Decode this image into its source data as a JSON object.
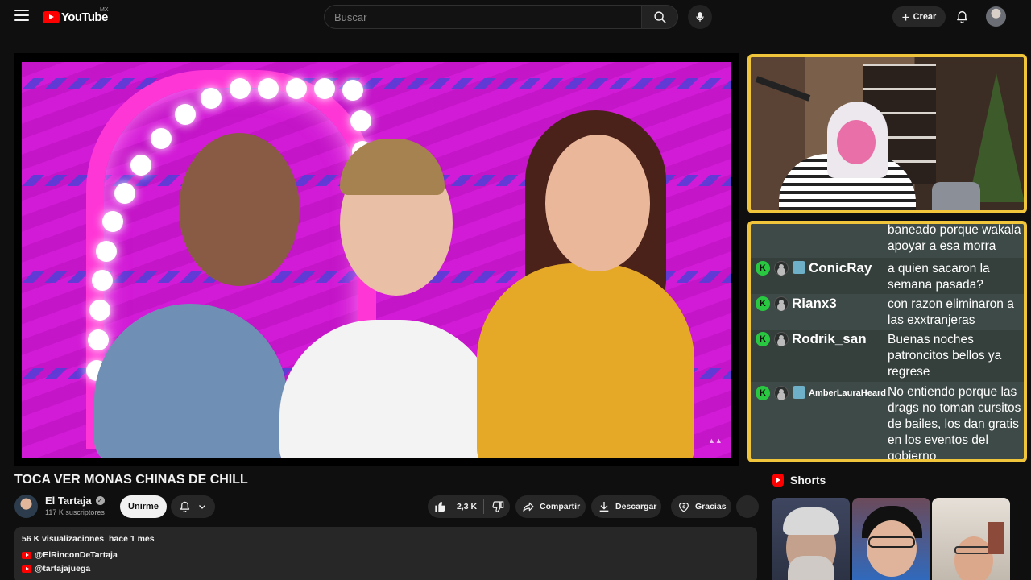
{
  "header": {
    "logo_text": "YouTube",
    "country_code": "MX",
    "search_placeholder": "Buscar",
    "create_label": "Crear"
  },
  "video": {
    "title": "TOCA VER MONAS CHINAS DE CHILL",
    "channel_name": "El Tartaja",
    "subscribers": "117 K suscriptores",
    "join_label": "Unirme",
    "likes": "2,3 K",
    "share_label": "Compartir",
    "download_label": "Descargar",
    "thanks_label": "Gracias"
  },
  "description": {
    "views": "56 K visualizaciones",
    "date": "hace 1 mes",
    "links": [
      "@ElRinconDeTartaja",
      "@tartajajuega"
    ]
  },
  "chat": {
    "messages": [
      {
        "user": "",
        "text": "baneado porque wakala apoyar a esa morra"
      },
      {
        "user": "ConicRay",
        "text": "a quien sacaron la semana pasada?"
      },
      {
        "user": "Rianx3",
        "text": "con razon eliminaron a las exxtranjeras sajdajsd"
      },
      {
        "user": "Rodrik_san",
        "text": "Buenas noches patroncitos bellos ya regrese"
      },
      {
        "user": "AmberLauraHeard",
        "text": "No entiendo porque las drags no toman cursitos de bailes, los dan gratis en los eventos del gobierno"
      }
    ],
    "kick_badge": "K"
  },
  "sidebar": {
    "shorts_label": "Shorts"
  },
  "colors": {
    "background": "#0f0f0f",
    "brand_red": "#ff0000",
    "overlay_border": "#f0c53c",
    "chat_bg": "#3e4a47",
    "kick_green": "#28c840"
  }
}
